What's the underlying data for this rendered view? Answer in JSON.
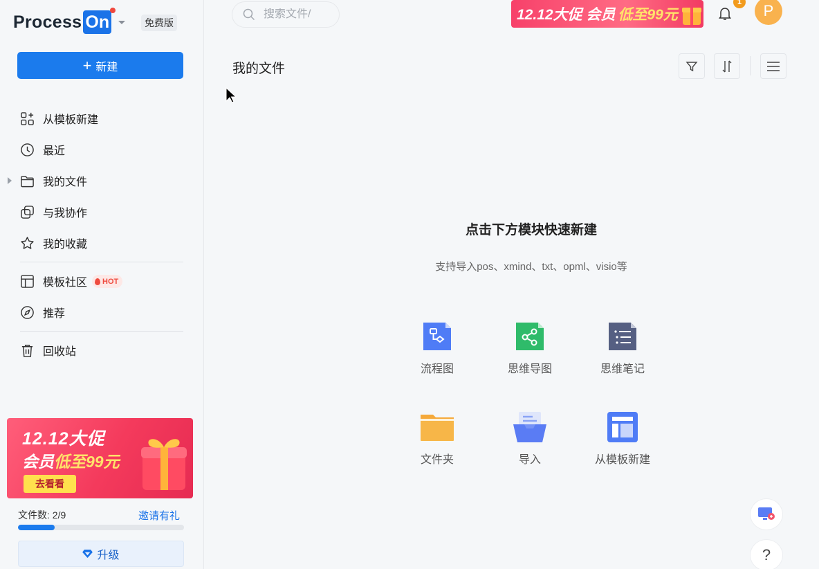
{
  "app": {
    "logo_text": "Process",
    "logo_highlight": "On",
    "plan_badge": "免费版"
  },
  "sidebar": {
    "new_button": "新建",
    "items": [
      {
        "label": "从模板新建",
        "icon": "template-grid-icon"
      },
      {
        "label": "最近",
        "icon": "clock-icon"
      },
      {
        "label": "我的文件",
        "icon": "folder-icon"
      },
      {
        "label": "与我协作",
        "icon": "collaborate-icon"
      },
      {
        "label": "我的收藏",
        "icon": "star-icon"
      },
      {
        "label": "模板社区",
        "icon": "layout-icon",
        "tag": "HOT"
      },
      {
        "label": "推荐",
        "icon": "compass-icon"
      },
      {
        "label": "回收站",
        "icon": "trash-icon"
      }
    ],
    "promo": {
      "line1": "12.12大促",
      "line2_prefix": "会员",
      "line2_highlight": "低至99元",
      "cta": "去看看"
    },
    "files_count": "文件数: 2/9",
    "files_progress": 0.222,
    "invite": "邀请有礼",
    "upgrade": "升级"
  },
  "topbar": {
    "search_placeholder": "搜索文件/",
    "banner_prefix": "12.12大促 会员",
    "banner_highlight": "低至99元",
    "notification_badge": "1",
    "avatar_letter": "P"
  },
  "main": {
    "title": "我的文件",
    "empty_title": "点击下方模块快速新建",
    "empty_subtitle": "支持导入pos、xmind、txt、opml、visio等",
    "tiles": [
      {
        "label": "流程图",
        "icon": "flowchart-icon",
        "color": "#4f7cf6"
      },
      {
        "label": "思维导图",
        "icon": "mindmap-icon",
        "color": "#2fbb6a"
      },
      {
        "label": "思维笔记",
        "icon": "mindnote-icon",
        "color": "#555f82"
      },
      {
        "label": "文件夹",
        "icon": "folder-tile-icon",
        "color": "#f5a93a"
      },
      {
        "label": "导入",
        "icon": "import-icon",
        "color": "#5a7cf4"
      },
      {
        "label": "从模板新建",
        "icon": "template-tile-icon",
        "color": "#4f7cf6"
      }
    ]
  },
  "colors": {
    "primary": "#1b7bed",
    "background": "#f5f7f9",
    "hot": "#ef4b3f"
  }
}
